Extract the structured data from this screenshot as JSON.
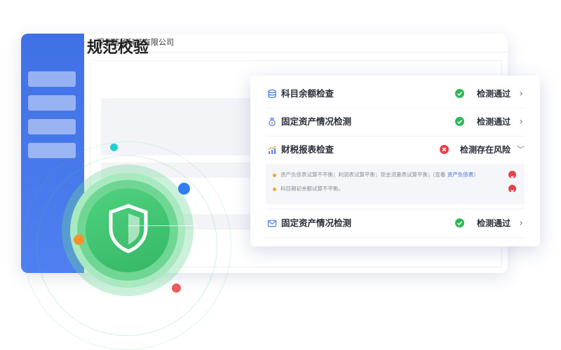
{
  "window": {
    "company": "深圳答税科技有限公司",
    "page_title": "规范校验"
  },
  "checks": [
    {
      "label": "科目余额检查",
      "status": "检测通过",
      "state": "pass",
      "icon": "database-icon"
    },
    {
      "label": "固定资产情况检测",
      "status": "检测通过",
      "state": "pass",
      "icon": "asset-bag-icon"
    },
    {
      "label": "财税报表检查",
      "status": "检测存在风险",
      "state": "risk",
      "icon": "chart-icon"
    },
    {
      "label": "固定资产情况检测",
      "status": "检测通过",
      "state": "pass",
      "icon": "envelope-icon"
    }
  ],
  "risk_details": [
    {
      "text": "资产负债表试算不平衡；利润表试算平衡；现金流量表试算平衡；(查看 ",
      "link": "资产负债表",
      "suffix": ")"
    },
    {
      "text": "科目期初余额试算不平衡。"
    }
  ],
  "colors": {
    "sidebar": "#4577ea",
    "pass": "#2fb657",
    "risk": "#e5404a",
    "link": "#3f6fe6",
    "shield": "#3ec46d"
  }
}
